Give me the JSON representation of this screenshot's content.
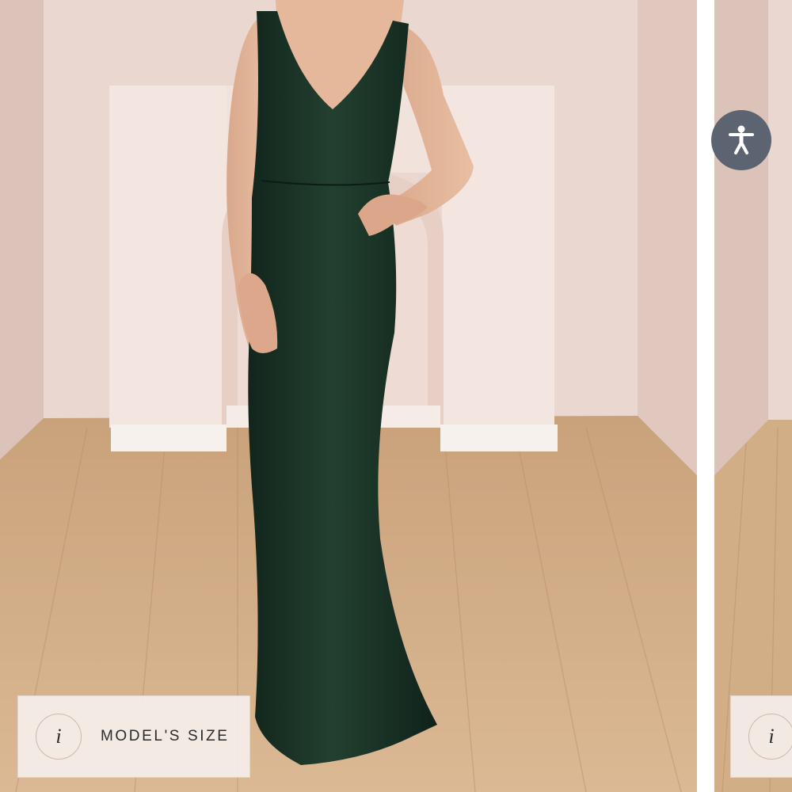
{
  "product_gallery": {
    "current_image_alt": "Model wearing a dark green velvet V-neck floor-length gown",
    "next_image_alt": "Next product image",
    "models_size_label": "MODEL'S SIZE",
    "info_glyph": "i"
  },
  "accessibility_widget": {
    "icon": "accessibility-person-icon",
    "label": "Accessibility"
  },
  "colors": {
    "accessibility_button": "#5b6470",
    "gown": "#1c3328",
    "wall": "#ead7d0",
    "floor": "#d2ae87",
    "label_background": "#f4eee9",
    "label_text": "#2b2b2b"
  }
}
